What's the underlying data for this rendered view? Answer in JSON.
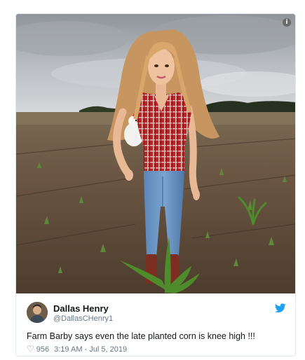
{
  "tweet": {
    "display_name": "Dallas Henry",
    "handle": "@DallasCHenry1",
    "text": "Farm Barby says even the late planted corn is knee high !!!",
    "like_count": "956",
    "timestamp": "3:19 AM - Jul 5, 2019"
  },
  "icons": {
    "info": "info-icon",
    "platform": "twitter-bird-icon",
    "like": "heart-icon"
  },
  "colors": {
    "brand_blue": "#1da1f2",
    "muted_text": "#657786",
    "border": "#e1e8ed"
  }
}
